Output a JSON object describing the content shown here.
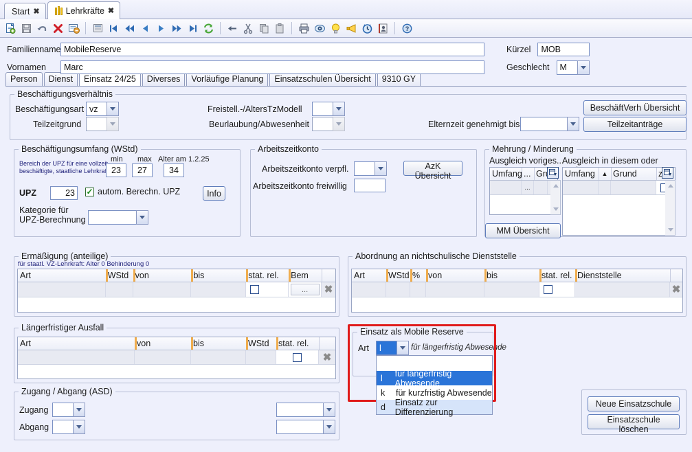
{
  "window_tabs": [
    {
      "label": "Start",
      "icon": "none",
      "active": false,
      "close": "✖"
    },
    {
      "label": "Lehrkräfte",
      "icon": "people-icon",
      "active": true,
      "close": "✖"
    }
  ],
  "toolbar": {
    "icons": [
      "new-document-icon",
      "save-icon",
      "undo-icon",
      "delete-icon",
      "form-remove-icon",
      "table-view-icon",
      "first-record-icon",
      "prev-page-icon",
      "prev-record-icon",
      "next-record-icon",
      "next-page-icon",
      "last-record-icon",
      "refresh-icon",
      "back-arrow-icon",
      "cut-icon",
      "copy-icon",
      "paste-icon",
      "print-icon",
      "preview-icon",
      "hint-icon",
      "megaphone-icon",
      "clock-icon",
      "address-book-icon",
      "help-icon"
    ]
  },
  "header": {
    "familienname_label": "Familienname",
    "familienname_value": "MobileReserve",
    "vornamen_label": "Vornamen",
    "vornamen_value": "Marc",
    "kuerzel_label": "Kürzel",
    "kuerzel_value": "MOB",
    "geschlecht_label": "Geschlecht",
    "geschlecht_value": "M"
  },
  "section_tabs": [
    {
      "label": "Person",
      "active": false
    },
    {
      "label": "Dienst",
      "active": false
    },
    {
      "label": "Einsatz 24/25",
      "active": true
    },
    {
      "label": "Diverses",
      "active": false
    },
    {
      "label": "Vorläufige Planung",
      "active": false
    },
    {
      "label": "Einsatzschulen Übersicht",
      "active": false
    },
    {
      "label": "9310 GY",
      "active": false
    }
  ],
  "beschaeftigungsverhaeltnis": {
    "legend": "Beschäftigungsverhältnis",
    "beschaeftigungsart_label": "Beschäftigungsart",
    "beschaeftigungsart_value": "vz",
    "teilzeitgrund_label": "Teilzeitgrund",
    "teilzeitgrund_value": "",
    "freistell_label": "Freistell.-/AltersTzModell",
    "freistell_value": "",
    "beurlaubung_label": "Beurlaubung/Abwesenheit",
    "beurlaubung_value": "",
    "elternzeit_label": "Elternzeit genehmigt bis",
    "elternzeit_value": "",
    "btn_beschaeftverh": "BeschäftVerh Übersicht",
    "btn_teilzeitantraege": "Teilzeitanträge"
  },
  "beschaeftigungsumfang": {
    "legend": "Beschäftigungsumfang (WStd)",
    "note_line1": "Bereich der UPZ für eine vollzeit-",
    "note_line2": "beschäftigte, staatliche Lehrkraft",
    "min_label": "min",
    "min_value": "23",
    "max_label": "max",
    "max_value": "27",
    "alter_label": "Alter am 1.2.25",
    "alter_value": "34",
    "upz_label": "UPZ",
    "upz_value": "23",
    "checkbox_label": "autom. Berechn. UPZ",
    "checkbox_checked": true,
    "info_btn": "Info",
    "kategorie_label_line1": "Kategorie für",
    "kategorie_label_line2": "UPZ-Berechnung",
    "kategorie_value": ""
  },
  "arbeitszeitkonto": {
    "legend": "Arbeitszeitkonto",
    "verpfl_label": "Arbeitszeitkonto verpfl.",
    "verpfl_value": "",
    "freiwillig_label": "Arbeitszeitkonto freiwillig",
    "freiwillig_value": "",
    "azk_btn": "AzK Übersicht"
  },
  "mehrung_minderung": {
    "legend": "Mehrung / Minderung",
    "left_title": "Ausgleich voriges...",
    "right_title": "Ausgleich in diesem oder nächs...",
    "left_headers": [
      "Umfang",
      "...",
      "Gru"
    ],
    "left_row": [
      "",
      "...",
      ""
    ],
    "right_headers": [
      "Umfang",
      "▲",
      "Grund",
      "zäh"
    ],
    "right_row": [
      "",
      "",
      "",
      ""
    ],
    "mm_btn": "MM Übersicht",
    "grid_icon": "grid-config-icon"
  },
  "ermaessigung": {
    "legend": "Ermäßigung (anteilige)",
    "subnote": "für staatl. VZ-Lehrkraft: Alter 0 Behinderung 0",
    "headers": [
      "Art",
      "WStd",
      "von",
      "bis",
      "stat. rel.",
      "Bem",
      ""
    ],
    "row": {
      "art": "",
      "wstd": "",
      "von": "",
      "bis": "",
      "stat_rel": false,
      "bem": "...",
      "delete_icon": "delete-row-icon"
    }
  },
  "abordnung": {
    "legend": "Abordnung an nichtschulische Dienststelle",
    "headers": [
      "Art",
      "WStd",
      "%",
      "von",
      "bis",
      "stat. rel.",
      "Dienststelle",
      ""
    ],
    "row": {
      "art": "",
      "wstd": "",
      "pct": "",
      "von": "",
      "bis": "",
      "stat_rel": false,
      "dienststelle": "",
      "delete_icon": "delete-row-icon"
    }
  },
  "laengerfristiger_ausfall": {
    "legend": "Längerfristiger Ausfall",
    "headers": [
      "Art",
      "von",
      "bis",
      "WStd",
      "stat. rel.",
      ""
    ],
    "row": {
      "art": "",
      "von": "",
      "bis": "",
      "wstd": "",
      "stat_rel": false,
      "delete_icon": "delete-row-icon"
    }
  },
  "einsatz_mobile_reserve": {
    "legend": "Einsatz als Mobile Reserve",
    "art_label": "Art",
    "art_value": "l",
    "art_description": "für längerfristig Abwesende",
    "highlight_color": "#e01b1b",
    "dropdown_open": true,
    "dropdown_items": [
      {
        "key": "",
        "label": "",
        "state": "blank"
      },
      {
        "key": "l",
        "label": "für längerfristig Abwesende",
        "state": "selected"
      },
      {
        "key": "k",
        "label": "für kurzfristig Abwesende",
        "state": "normal"
      },
      {
        "key": "d",
        "label": "Einsatz zur Differenzierung",
        "state": "hover"
      }
    ]
  },
  "zugang_abgang": {
    "legend": "Zugang / Abgang (ASD)",
    "zugang_label": "Zugang",
    "zugang_value": "",
    "zugang_value2": "",
    "abgang_label": "Abgang",
    "abgang_value": "",
    "abgang_value2": ""
  },
  "einsatzschule_buttons": {
    "neu": "Neue Einsatzschule",
    "loeschen": "Einsatzschule löschen"
  }
}
